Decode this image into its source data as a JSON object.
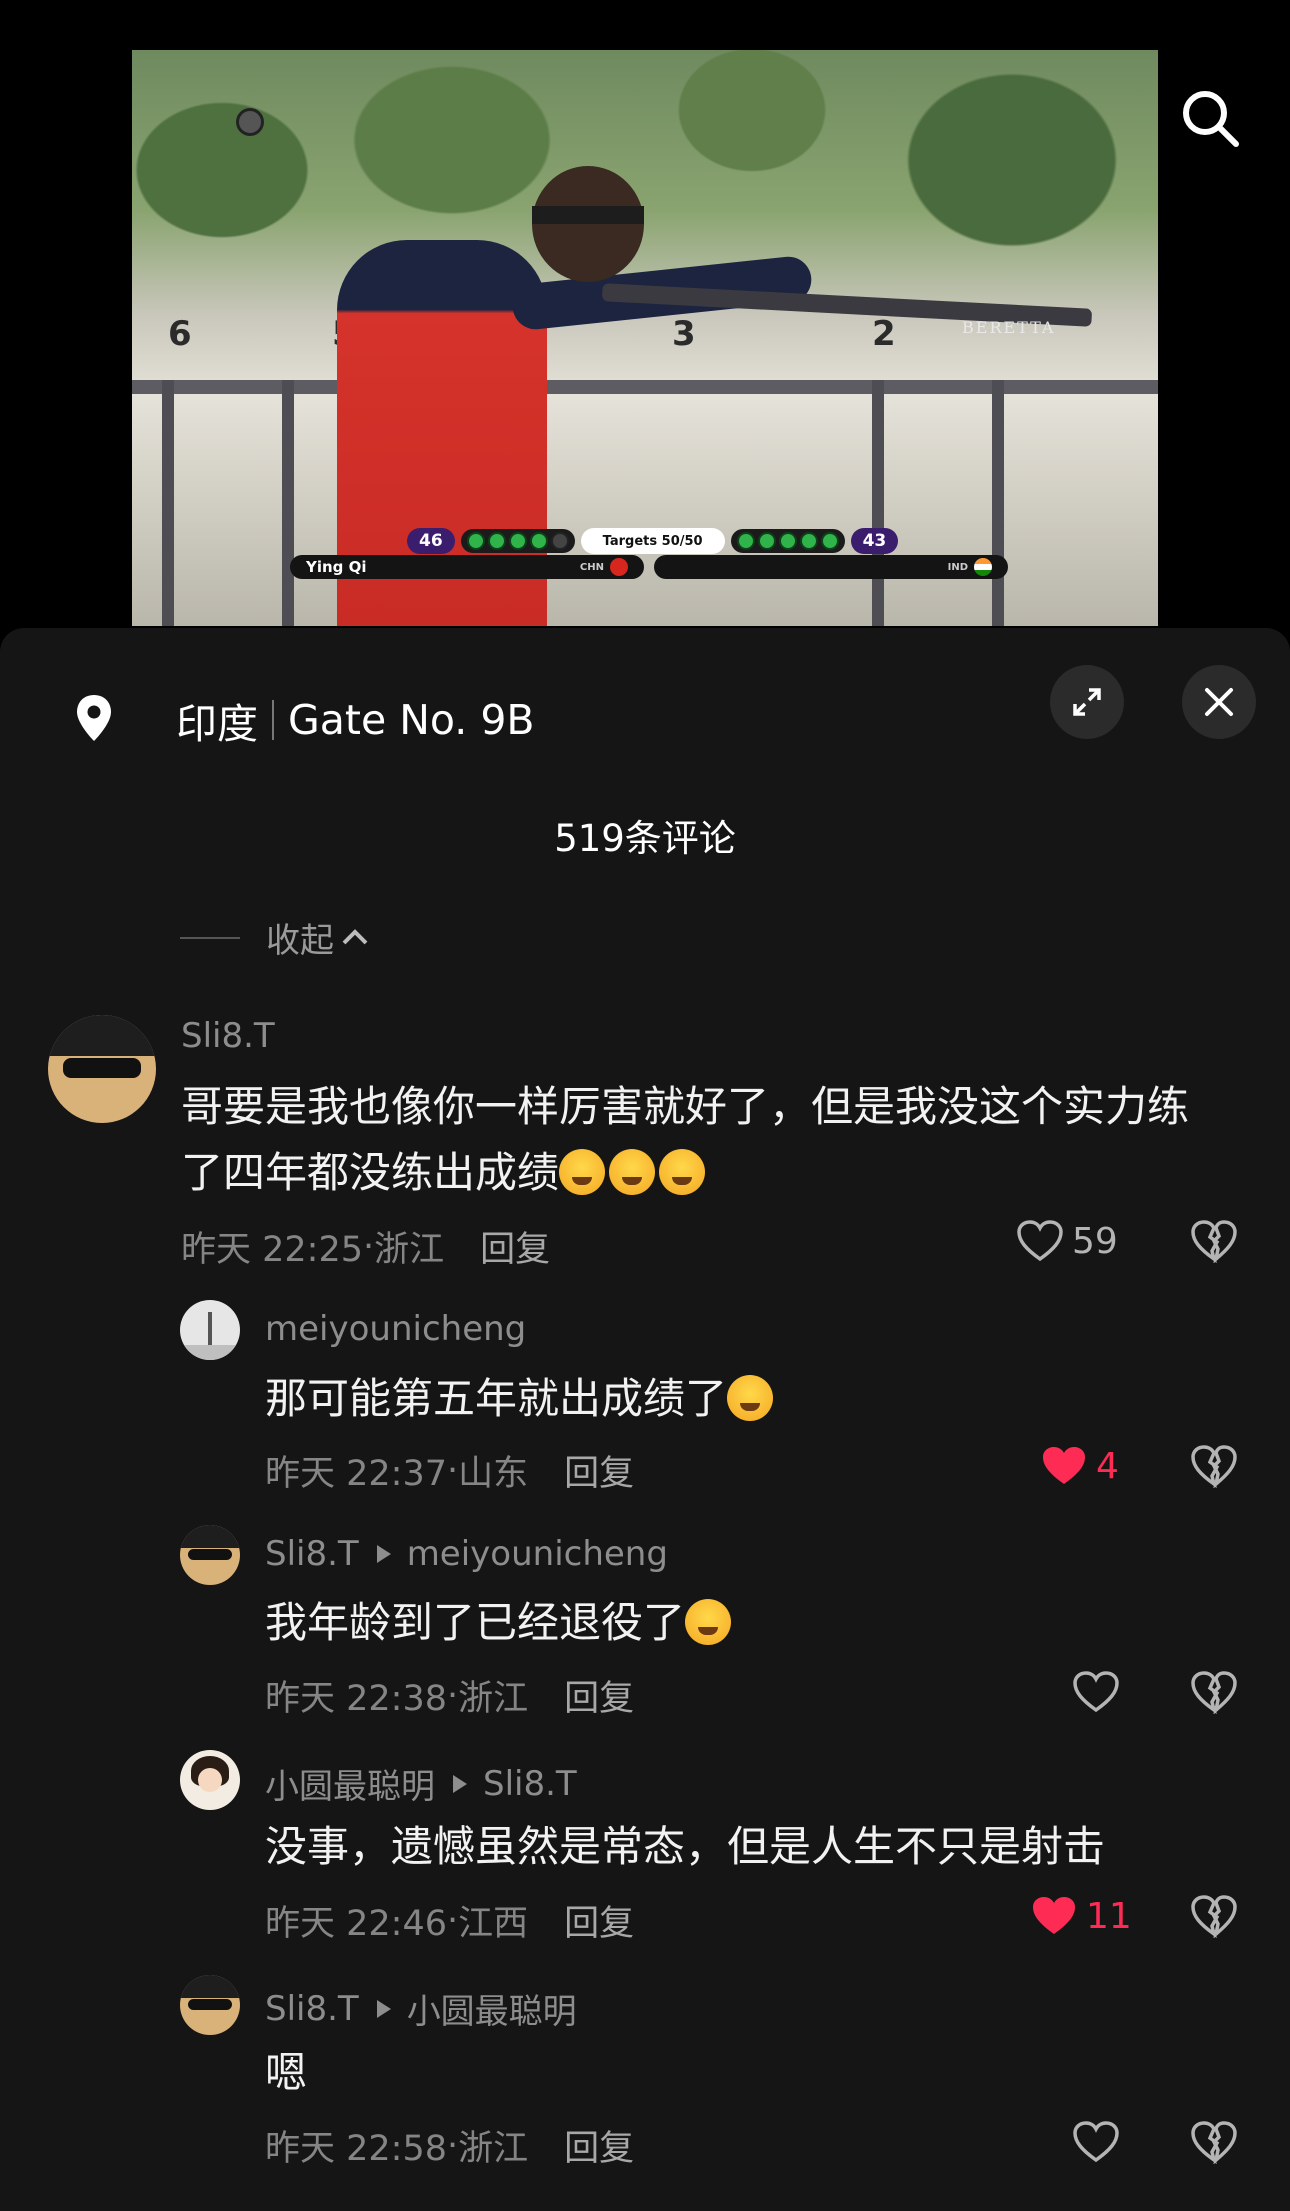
{
  "video": {
    "gun_brand": "BERETTA",
    "station_numbers": [
      "6",
      "5",
      "3",
      "2"
    ],
    "scoreboard": {
      "left_score": "46",
      "right_score": "43",
      "targets_label": "Targets 50/50",
      "left_name": "Ying Qi",
      "left_country": "CHN",
      "right_country": "IND"
    }
  },
  "location": {
    "country": "印度",
    "place": "Gate No. 9B"
  },
  "comment_count_title": "519条评论",
  "collapse_label": "收起",
  "comments": [
    {
      "user": "Sli8.T",
      "reply_to": "",
      "text_line1": "哥要是我也像你一样厉害就好了，但是我没这个实力练",
      "text_line2": "了四年都没练出成绩",
      "time": "昨天 22:25",
      "region": "浙江",
      "reply_label": "回复",
      "likes": "59",
      "liked": false
    },
    {
      "user": "meiyounicheng",
      "reply_to": "",
      "text": "那可能第五年就出成绩了",
      "time": "昨天 22:37",
      "region": "山东",
      "reply_label": "回复",
      "likes": "4",
      "liked": true
    },
    {
      "user": "Sli8.T",
      "reply_to": "meiyounicheng",
      "text": "我年龄到了已经退役了",
      "time": "昨天 22:38",
      "region": "浙江",
      "reply_label": "回复",
      "likes": "",
      "liked": false
    },
    {
      "user": "小圆最聪明",
      "reply_to": "Sli8.T",
      "text": "没事，遗憾虽然是常态，但是人生不只是射击",
      "time": "昨天 22:46",
      "region": "江西",
      "reply_label": "回复",
      "likes": "11",
      "liked": true
    },
    {
      "user": "Sli8.T",
      "reply_to": "小圆最聪明",
      "text": "嗯",
      "time": "昨天 22:58",
      "region": "浙江",
      "reply_label": "回复",
      "likes": "",
      "liked": false
    }
  ],
  "colors": {
    "sheet_bg": "#151515",
    "like_active": "#fe2c55",
    "muted_text": "#8d8d8d"
  },
  "icons": [
    "search-icon",
    "location-pin-icon",
    "expand-icon",
    "close-icon",
    "heart-icon",
    "broken-heart-icon",
    "chevron-up-icon"
  ]
}
